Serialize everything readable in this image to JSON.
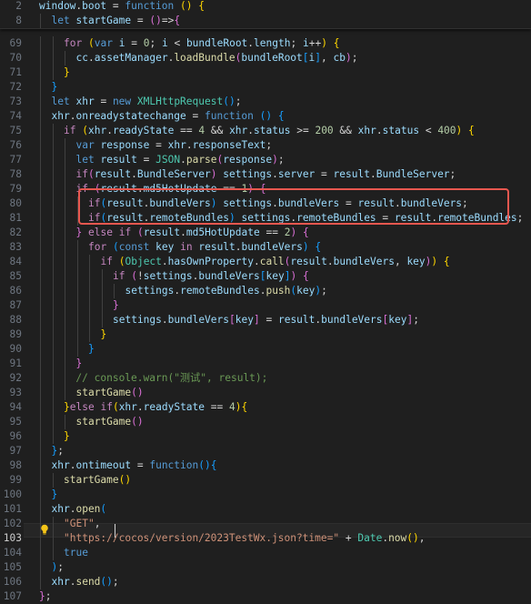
{
  "editor": {
    "active_line": "103",
    "lines": [
      {
        "num": "2",
        "text": "window.boot = function () {"
      },
      {
        "num": "8",
        "text": "  let startGame = ()=>{"
      },
      {
        "num": "69",
        "text": "    for (var i = 0; i < bundleRoot.length; i++) {"
      },
      {
        "num": "70",
        "text": "      cc.assetManager.loadBundle(bundleRoot[i], cb);"
      },
      {
        "num": "71",
        "text": "    }"
      },
      {
        "num": "72",
        "text": "  }"
      },
      {
        "num": "73",
        "text": "  let xhr = new XMLHttpRequest();"
      },
      {
        "num": "74",
        "text": "  xhr.onreadystatechange = function () {"
      },
      {
        "num": "75",
        "text": "    if (xhr.readyState == 4 && xhr.status >= 200 && xhr.status < 400) {"
      },
      {
        "num": "76",
        "text": "      var response = xhr.responseText;"
      },
      {
        "num": "77",
        "text": "      let result = JSON.parse(response);"
      },
      {
        "num": "78",
        "text": "      if(result.BundleServer) settings.server = result.BundleServer;"
      },
      {
        "num": "79",
        "text": "      if (result.md5HotUpdate == 1) {"
      },
      {
        "num": "80",
        "text": "        if(result.bundleVers) settings.bundleVers = result.bundleVers;"
      },
      {
        "num": "81",
        "text": "        if(result.remoteBundles) settings.remoteBundles = result.remoteBundles;"
      },
      {
        "num": "82",
        "text": "      } else if (result.md5HotUpdate == 2) {"
      },
      {
        "num": "83",
        "text": "        for (const key in result.bundleVers) {"
      },
      {
        "num": "84",
        "text": "          if (Object.hasOwnProperty.call(result.bundleVers, key)) {"
      },
      {
        "num": "85",
        "text": "            if (!settings.bundleVers[key]) {"
      },
      {
        "num": "86",
        "text": "              settings.remoteBundles.push(key);"
      },
      {
        "num": "87",
        "text": "            }"
      },
      {
        "num": "88",
        "text": "            settings.bundleVers[key] = result.bundleVers[key];"
      },
      {
        "num": "89",
        "text": "          }"
      },
      {
        "num": "90",
        "text": "        }"
      },
      {
        "num": "91",
        "text": "      }"
      },
      {
        "num": "92",
        "text": "      // console.warn(\"测试\", result);"
      },
      {
        "num": "93",
        "text": "      startGame()"
      },
      {
        "num": "94",
        "text": "    }else if(xhr.readyState == 4){"
      },
      {
        "num": "95",
        "text": "      startGame()"
      },
      {
        "num": "96",
        "text": "    }"
      },
      {
        "num": "97",
        "text": "  };"
      },
      {
        "num": "98",
        "text": "  xhr.ontimeout = function(){"
      },
      {
        "num": "99",
        "text": "    startGame()"
      },
      {
        "num": "100",
        "text": "  }"
      },
      {
        "num": "101",
        "text": "  xhr.open("
      },
      {
        "num": "102",
        "text": "    \"GET\","
      },
      {
        "num": "103",
        "text": "    \"https://cocos/version/2023TestWx.json?time=\" + Date.now(),"
      },
      {
        "num": "104",
        "text": "    true"
      },
      {
        "num": "105",
        "text": "  );"
      },
      {
        "num": "106",
        "text": "  xhr.send();"
      },
      {
        "num": "107",
        "text": "};"
      }
    ]
  },
  "colors": {
    "background": "#1f1f1f",
    "keyword": "#569cd6",
    "control": "#c586c0",
    "variable": "#9cdcfe",
    "function": "#dcdcaa",
    "class": "#4ec9b0",
    "string": "#ce9178",
    "number": "#b5cea8",
    "comment": "#6a9955",
    "highlight_box": "#e8574f"
  },
  "icons": {
    "lightbulb": "lightbulb-icon"
  }
}
